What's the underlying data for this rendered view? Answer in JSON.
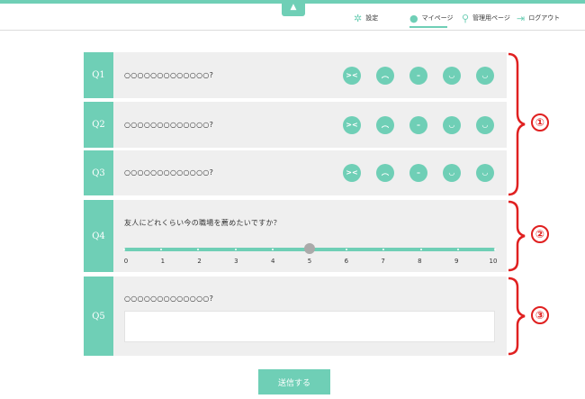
{
  "header": {
    "collapse_icon": "▲",
    "nav": [
      {
        "label": "設定",
        "icon": "gear-icon"
      },
      {
        "label": "マイページ",
        "icon": "person-icon"
      },
      {
        "label": "管理用ページ",
        "icon": "key-icon"
      },
      {
        "label": "ログアウト",
        "icon": "logout-icon"
      }
    ],
    "active_nav": "マイページ"
  },
  "questions": {
    "q1": {
      "label": "Q1",
      "text": "○○○○○○○○○○○○○?"
    },
    "q2": {
      "label": "Q2",
      "text": "○○○○○○○○○○○○○?"
    },
    "q3": {
      "label": "Q3",
      "text": "○○○○○○○○○○○○○?"
    },
    "q4": {
      "label": "Q4",
      "text": "友人にどれくらい今の職場を薦めたいですか？",
      "slider_value": 5,
      "slider_min": 0,
      "slider_max": 10,
      "ticks": [
        "0",
        "1",
        "2",
        "3",
        "4",
        "5",
        "6",
        "7",
        "8",
        "9",
        "10"
      ]
    },
    "q5": {
      "label": "Q5",
      "text": "○○○○○○○○○○○○○?",
      "answer_value": ""
    }
  },
  "faces": [
    "very-bad-face-icon",
    "bad-face-icon",
    "neutral-face-icon",
    "good-face-icon",
    "very-good-face-icon"
  ],
  "markers": {
    "m1": "①",
    "m2": "②",
    "m3": "③"
  },
  "submit_label": "送信する",
  "colors": {
    "accent": "#6fcfb6",
    "marker": "#e02020",
    "row_bg": "#efefef"
  }
}
